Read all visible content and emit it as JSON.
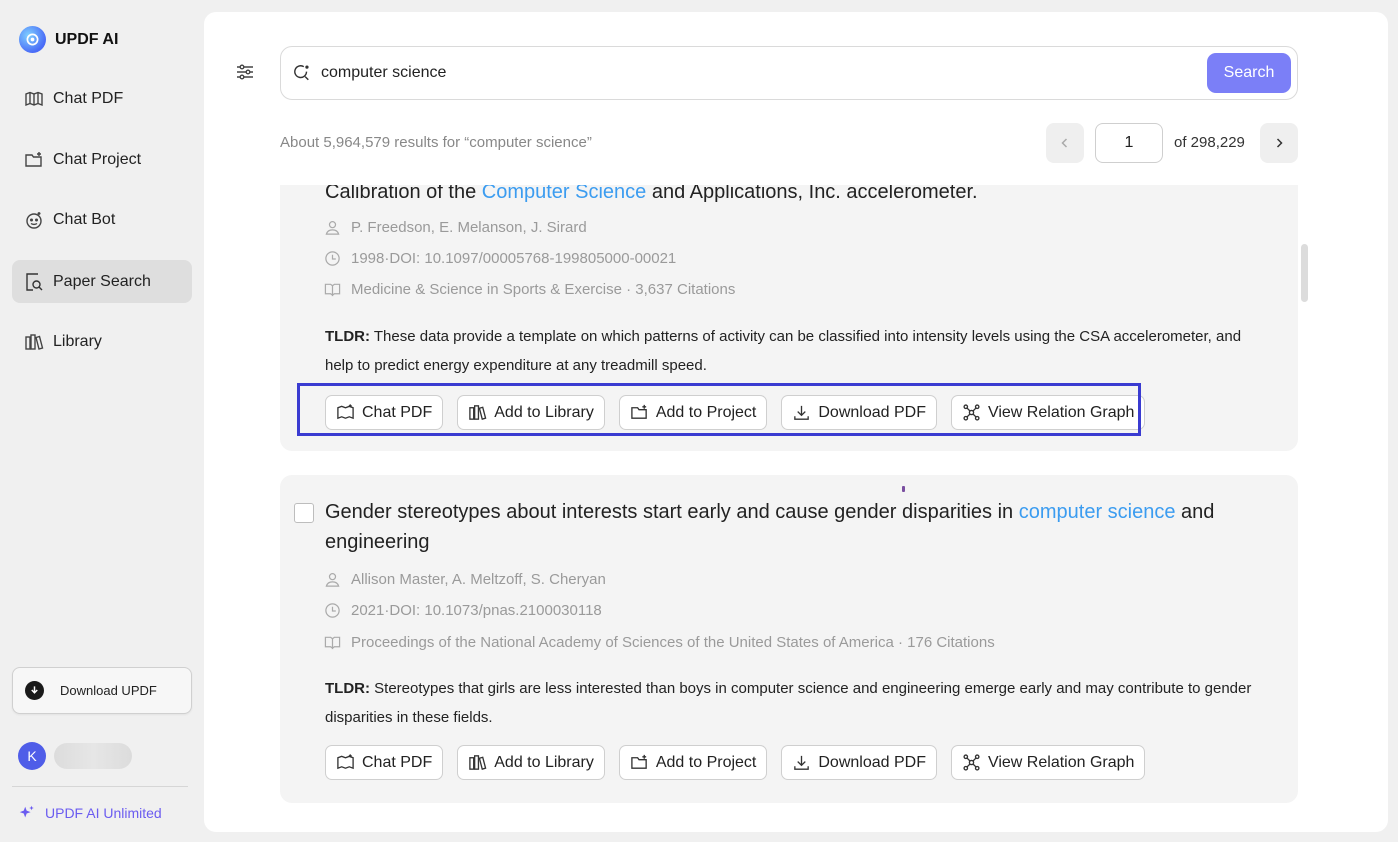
{
  "app": {
    "name": "UPDF AI"
  },
  "sidebar": {
    "items": [
      {
        "label": "Chat PDF",
        "icon": "book-open-icon"
      },
      {
        "label": "Chat Project",
        "icon": "folder-plus-icon"
      },
      {
        "label": "Chat Bot",
        "icon": "bot-icon"
      },
      {
        "label": "Paper Search",
        "icon": "doc-search-icon",
        "active": true
      },
      {
        "label": "Library",
        "icon": "library-icon"
      }
    ],
    "download_label": "Download UPDF",
    "user_initial": "K",
    "unlimited_label": "UPDF AI Unlimited"
  },
  "search": {
    "query": "computer science",
    "button_label": "Search"
  },
  "results": {
    "summary": "About 5,964,579 results for “computer science”",
    "current_page": "1",
    "total_pages_label": "of 298,229"
  },
  "papers": [
    {
      "title_before": "Calibration of the ",
      "title_highlight": "Computer Science",
      "title_after": " and Applications, Inc. accelerometer.",
      "authors": "P. Freedson,  E. Melanson,  J. Sirard",
      "date_doi": "1998·DOI: 10.1097/00005768-199805000-00021",
      "venue": "Medicine & Science in Sports & Exercise · 3,637 Citations",
      "tldr_label": "TLDR:",
      "tldr": " These data provide a template on which patterns of activity can be classified into intensity levels using the CSA accelerometer, and help to predict energy expenditure at any treadmill speed."
    },
    {
      "title_before": "Gender stereotypes about interests start early and cause gender disparities in ",
      "title_highlight": "computer science",
      "title_after": " and engineering",
      "authors": "Allison Master,  A. Meltzoff,  S. Cheryan",
      "date_doi": "2021·DOI: 10.1073/pnas.2100030118",
      "venue": "Proceedings of the National Academy of Sciences of the United States of America · 176 Citations",
      "tldr_label": "TLDR:",
      "tldr": " Stereotypes that girls are less interested than boys in computer science and engineering emerge early and may contribute to gender disparities in these fields."
    }
  ],
  "actions": {
    "chat_pdf": "Chat PDF",
    "add_library": "Add to Library",
    "add_project": "Add to Project",
    "download_pdf": "Download PDF",
    "relation_graph": "View Relation Graph"
  },
  "colors": {
    "accent": "#7b7ff7",
    "highlight_text": "#3b9cf0",
    "annotation_box": "#3a3bd1",
    "unlimited": "#6b5cf0"
  }
}
